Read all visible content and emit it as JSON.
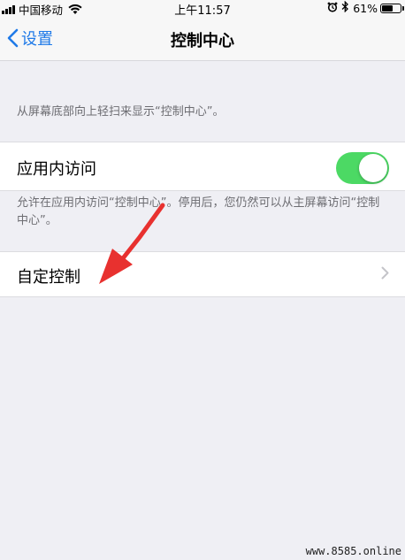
{
  "status_bar": {
    "carrier": "中国移动",
    "time": "上午11:57",
    "battery_percent": "61%",
    "battery_level": 0.61,
    "icons": [
      "signal-icon",
      "wifi-icon",
      "alarm-icon",
      "bluetooth-icon",
      "battery-icon"
    ]
  },
  "nav": {
    "back_label": "设置",
    "title": "控制中心"
  },
  "header_hint": "从屏幕底部向上轻扫来显示“控制中心”。",
  "access_within_apps": {
    "label": "应用内访问",
    "enabled": true,
    "footer": "允许在应用内访问“控制中心”。停用后，您仍然可以从主屏幕访问“控制中心”。"
  },
  "customize": {
    "label": "自定控制"
  },
  "colors": {
    "accent": "#1f7ae8",
    "toggle_on": "#4cd964",
    "annotation_arrow": "#e8312f",
    "background": "#efeff4"
  },
  "watermark": "www.8585.online"
}
